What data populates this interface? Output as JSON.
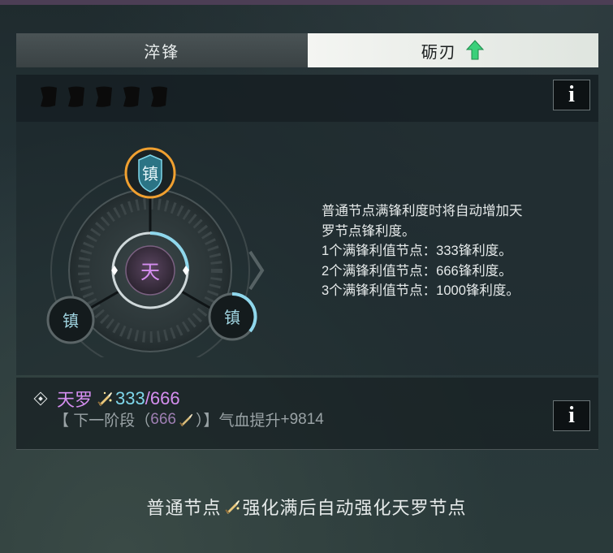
{
  "tabs": [
    {
      "label": "淬锋"
    },
    {
      "label": "砺刃"
    }
  ],
  "node_center": "天",
  "node_top": "镇",
  "node_left": "镇",
  "node_right": "镇",
  "description": [
    "普通节点满锋利度时将自动增加天",
    "罗节点锋利度。",
    "1个满锋利值节点：333锋利度。",
    "2个满锋利值节点：666锋利度。",
    "3个满锋利值节点：1000锋利度。"
  ],
  "info_label": "i",
  "status": {
    "name": "天罗",
    "current": "333",
    "sep": "/",
    "max": "666",
    "next_prefix": "【 下一阶段（ ",
    "next_value": "666",
    "next_suffix": "）】气血提升",
    "bonus": "+9814"
  },
  "tip_part1": "普通节点",
  "tip_part2": "强化满后自动强化天罗节点",
  "colors": {
    "accent_orange": "#f0a030",
    "accent_cyan": "#7fd6ea",
    "accent_purple": "#d58ef0",
    "up_arrow": "#3ad07a"
  },
  "icons": {
    "up_arrow": "up-arrow-icon",
    "sharpness": "sword-sharpness-icon",
    "flag": "black-flag-icon",
    "info": "info-icon"
  }
}
